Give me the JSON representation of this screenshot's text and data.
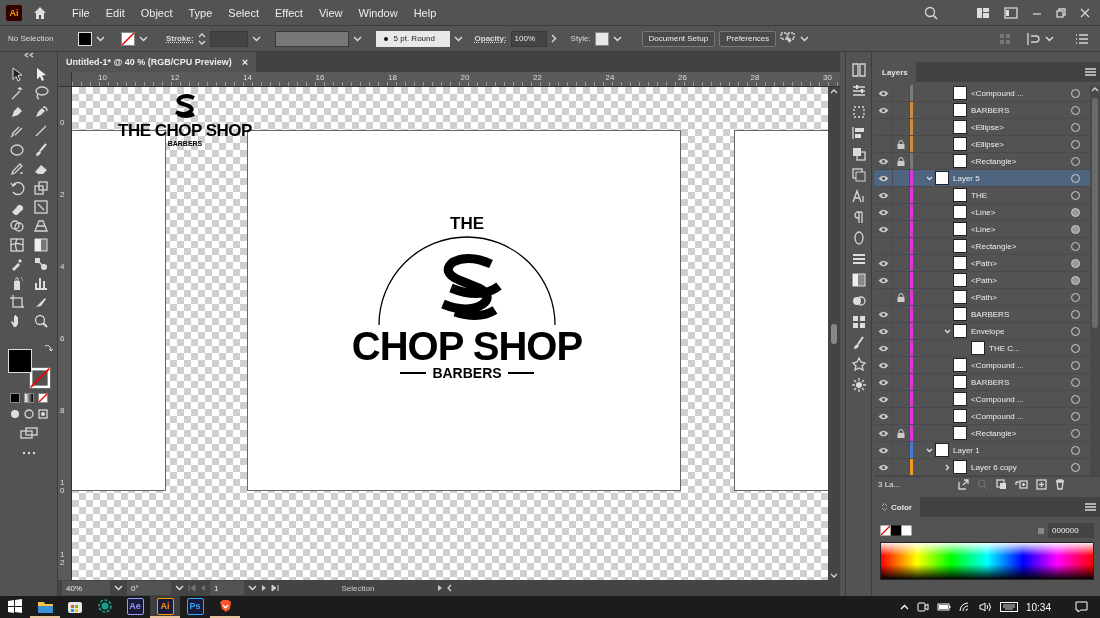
{
  "menu_bar": {
    "app_badge": "Ai",
    "items": [
      "File",
      "Edit",
      "Object",
      "Type",
      "Select",
      "Effect",
      "View",
      "Window",
      "Help"
    ]
  },
  "control_bar": {
    "selection": "No Selection",
    "stroke_label": "Stroke:",
    "brush": "5 pt. Round",
    "opacity_label": "Opacity:",
    "opacity": "100%",
    "style_label": "Style:",
    "buttons": [
      "Document Setup",
      "Preferences"
    ]
  },
  "document_tab": {
    "title": "Untitled-1* @ 40 % (RGB/CPU Preview)",
    "close": "×"
  },
  "rulers": {
    "horizontal": [
      "10",
      "12",
      "14",
      "16",
      "18",
      "20",
      "22",
      "24",
      "26",
      "28",
      "30"
    ],
    "vertical": [
      "0",
      "2",
      "4",
      "6",
      "8",
      "10",
      "12"
    ]
  },
  "canvas": {
    "small_logo": {
      "title": "THE CHOP SHOP",
      "subtitle": "BARBERS"
    },
    "logo": {
      "top": "THE",
      "title": "CHOP SHOP",
      "subtitle": "BARBERS"
    }
  },
  "status_bar": {
    "zoom": "40%",
    "rotation": "0°",
    "artboard": "1",
    "tool": "Selection"
  },
  "layers_panel": {
    "tab": "Layers",
    "rows_above": [
      {
        "name": "<Compound ...",
        "visible": true,
        "locked": false,
        "color": "#7a7a7a",
        "target_filled": false,
        "selected": false
      },
      {
        "name": "BARBERS",
        "visible": true,
        "locked": false,
        "color": "#d08a3c",
        "target_filled": false,
        "selected": false
      },
      {
        "name": "<Ellipse>",
        "visible": false,
        "locked": false,
        "color": "#d08a3c",
        "target_filled": false,
        "selected": false
      },
      {
        "name": "<Ellipse>",
        "visible": false,
        "locked": true,
        "color": "#d08a3c",
        "target_filled": false,
        "selected": false
      },
      {
        "name": "<Rectangle>",
        "visible": true,
        "locked": true,
        "color": "#7a7a7a",
        "target_filled": false,
        "selected": false
      }
    ],
    "layers": [
      {
        "name": "Layer 5",
        "visible": true,
        "locked": false,
        "color": "#e033e0",
        "target_filled": false,
        "selected": true,
        "expanded": true,
        "children": [
          {
            "name": "THE",
            "visible": true,
            "locked": false,
            "color": "#e033e0",
            "target_filled": false,
            "selected": false
          },
          {
            "name": "<Line>",
            "visible": true,
            "locked": false,
            "color": "#e033e0",
            "target_filled": true,
            "selected": false
          },
          {
            "name": "<Line>",
            "visible": true,
            "locked": false,
            "color": "#e033e0",
            "target_filled": true,
            "selected": false
          },
          {
            "name": "<Rectangle>",
            "visible": false,
            "locked": false,
            "color": "#e033e0",
            "target_filled": false,
            "selected": false
          },
          {
            "name": "<Path>",
            "visible": true,
            "locked": false,
            "color": "#e033e0",
            "target_filled": true,
            "selected": false
          },
          {
            "name": "<Path>",
            "visible": true,
            "locked": false,
            "color": "#e033e0",
            "target_filled": true,
            "selected": false
          },
          {
            "name": "<Path>",
            "visible": false,
            "locked": true,
            "color": "#e033e0",
            "target_filled": false,
            "selected": false
          },
          {
            "name": "BARBERS",
            "visible": true,
            "locked": false,
            "color": "#e033e0",
            "target_filled": false,
            "selected": false
          },
          {
            "name": "Envelope",
            "visible": true,
            "locked": false,
            "color": "#e033e0",
            "target_filled": false,
            "selected": false,
            "expanded": true,
            "children": [
              {
                "name": "THE C...",
                "visible": true,
                "locked": false,
                "color": "#e033e0",
                "target_filled": false,
                "selected": false
              }
            ]
          },
          {
            "name": "<Compound ...",
            "visible": true,
            "locked": false,
            "color": "#e033e0",
            "target_filled": false,
            "selected": false
          },
          {
            "name": "BARBERS",
            "visible": true,
            "locked": false,
            "color": "#e033e0",
            "target_filled": false,
            "selected": false
          },
          {
            "name": "<Compound ...",
            "visible": true,
            "locked": false,
            "color": "#e033e0",
            "target_filled": false,
            "selected": false
          },
          {
            "name": "<Compound ...",
            "visible": true,
            "locked": false,
            "color": "#e033e0",
            "target_filled": false,
            "selected": false
          },
          {
            "name": "<Rectangle>",
            "visible": true,
            "locked": true,
            "color": "#e033e0",
            "target_filled": false,
            "selected": false
          }
        ]
      },
      {
        "name": "Layer 1",
        "visible": true,
        "locked": false,
        "color": "#4a78d6",
        "target_filled": false,
        "selected": false,
        "expanded": true,
        "children": [
          {
            "name": "Layer 6 copy",
            "visible": true,
            "locked": false,
            "color": "#f09a28",
            "target_filled": false,
            "selected": false,
            "expanded": false
          }
        ]
      }
    ],
    "footer": "3 La..."
  },
  "color_panel": {
    "tab": "Color",
    "hex": "000000"
  },
  "taskbar": {
    "apps": [
      {
        "kind": "explorer",
        "running": true,
        "active": false
      },
      {
        "kind": "store",
        "running": false,
        "active": false
      },
      {
        "kind": "circle",
        "running": false,
        "active": false
      },
      {
        "kind": "badge",
        "label": "Ae",
        "color": "#9999ff",
        "running": false,
        "active": false
      },
      {
        "kind": "badge",
        "label": "Ai",
        "color": "#ff9a00",
        "running": true,
        "active": true
      },
      {
        "kind": "badge",
        "label": "Ps",
        "color": "#31a8ff",
        "running": false,
        "active": false
      },
      {
        "kind": "brave",
        "running": true,
        "active": false
      }
    ],
    "time": "10:34"
  }
}
